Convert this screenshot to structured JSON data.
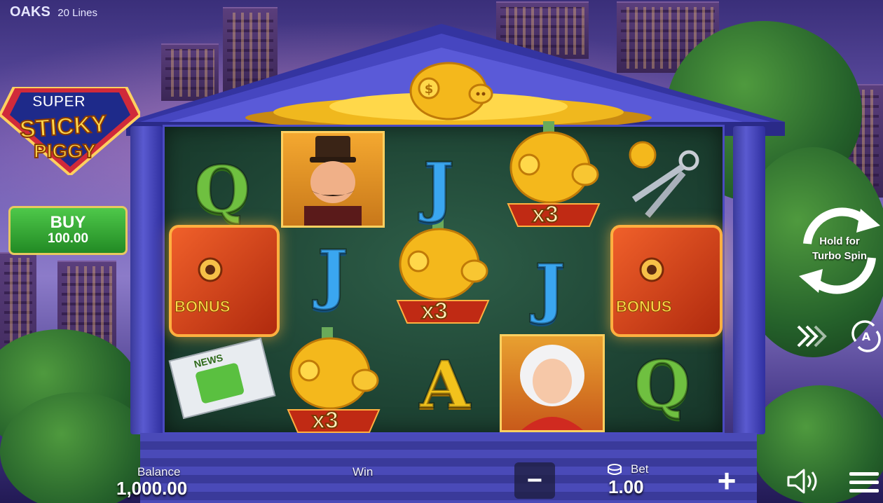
{
  "game": {
    "brand": "OAKS",
    "lines": "20 Lines",
    "logo_line1": "SUPER",
    "logo_line2": "STICKY",
    "logo_line3": "PIGGY"
  },
  "buy": {
    "label": "BUY",
    "price": "100.00"
  },
  "spin": {
    "line1": "Hold for",
    "line2": "Turbo Spin"
  },
  "reels": {
    "symbols": [
      [
        "Q",
        "J",
        "BONUS"
      ],
      [
        "tycoon",
        "J",
        "piggy x3"
      ],
      [
        "coin-piggy",
        "piggy x3",
        "A"
      ],
      [
        "piggy x3",
        "J",
        "blonde-lady"
      ],
      [
        "keys",
        "BONUS",
        "Q"
      ]
    ],
    "bonus_text": "BONUS",
    "multiplier": "x3",
    "news_text": "NEWS"
  },
  "bottom_bar": {
    "balance_label": "Balance",
    "balance_value": "1,000.00",
    "win_label": "Win",
    "bet_label": "Bet",
    "bet_value": "1.00",
    "minus_symbol": "−",
    "plus_symbol": "+"
  },
  "icons": {
    "fast_forward": "fast-forward-icon",
    "autoplay": "autoplay-icon",
    "sound": "speaker-icon",
    "menu": "hamburger-menu-icon",
    "coins": "coin-stack-icon"
  },
  "colors": {
    "buy_green": "#2fa82e",
    "reel_bg": "#1e4434",
    "temple_blue": "#4a4ac0",
    "gold": "#f2c21c"
  }
}
